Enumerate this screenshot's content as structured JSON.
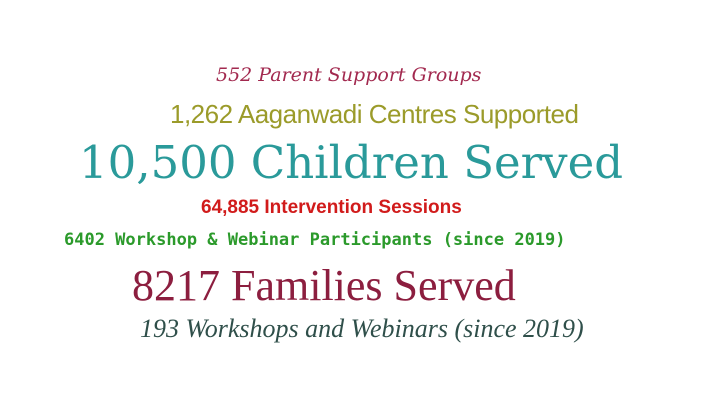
{
  "stats": [
    {
      "text": "552 Parent Support Groups",
      "color": "#a2294f"
    },
    {
      "text": "1,262 Aaganwadi Centres Supported",
      "color": "#9b9b2a"
    },
    {
      "text": "10,500 Children Served",
      "color": "#2a9a9a"
    },
    {
      "text": "64,885 Intervention Sessions",
      "color": "#d11b1b"
    },
    {
      "text": "6402 Workshop & Webinar Participants (since 2019)",
      "color": "#2b9a2b"
    },
    {
      "text": "8217 Families Served",
      "color": "#8c1e3f"
    },
    {
      "text": "193 Workshops and Webinars (since 2019)",
      "color": "#2f4f4a"
    }
  ]
}
